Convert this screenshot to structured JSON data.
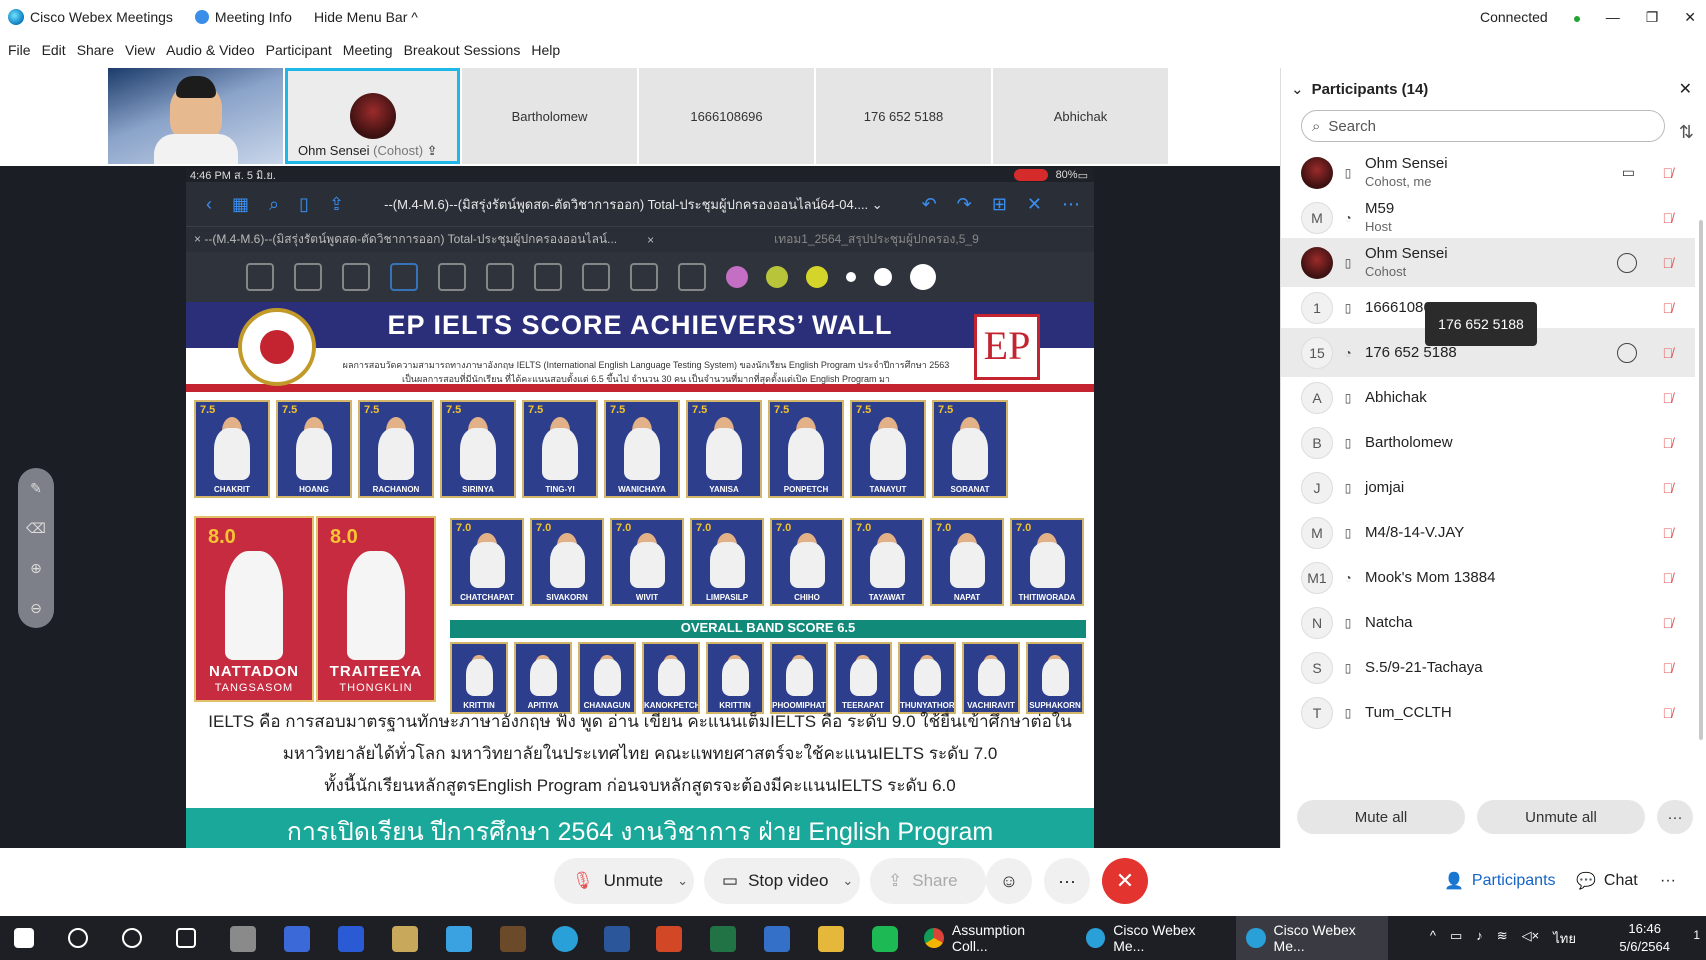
{
  "titlebar": {
    "app_name": "Cisco Webex Meetings",
    "meeting_info": "Meeting Info",
    "hide_menu": "Hide Menu Bar ^",
    "connection": "Connected",
    "win_minimize": "—",
    "win_restore": "❐",
    "win_close": "✕"
  },
  "menu": [
    "File",
    "Edit",
    "Share",
    "View",
    "Audio & Video",
    "Participant",
    "Meeting",
    "Breakout Sessions",
    "Help"
  ],
  "thumbnails": {
    "t2_name": "Ohm Sensei",
    "t2_role": "(Cohost)",
    "t3": "Bartholomew",
    "t4": "1666108696",
    "t5": "176 652 5188",
    "t6": "Abhichak"
  },
  "tablet": {
    "time": "4:46 PM  ส. 5 มิ.ย.",
    "battery": "80%",
    "doc_title": "--(M.4-M.6)--(มิสรุ่งรัตน์พูดสด-ตัดวิชาการออก) Total-ประชุมผู้ปกครองออนไลน์64-04.... ⌄",
    "tab1": "×  --(M.4-M.6)--(มิสรุ่งรัตน์พูดสด-ตัดวิชาการออก) Total-ประชุมผู้ปกครองออนไลน์...",
    "tab1_close": "×",
    "tab2": "เทอม1_2564_สรุปประชุมผู้ปกครอง,5_9"
  },
  "poster": {
    "title": "EP IELTS SCORE ACHIEVERS’ WALL",
    "logo": "EP",
    "sub1": "ผลการสอบวัดความสามารถทางภาษาอังกฤษ IELTS (International English Language Testing System) ของนักเรียน English Program ประจำปีการศึกษา 2563",
    "sub2": "เป็นผลการสอบที่มีนักเรียน ที่ได้คะแนนสอบตั้งแต่ 6.5 ขึ้นไป จำนวน 30 คน เป็นจำนวนที่มากที่สุดตั้งแต่เปิด English Program มา",
    "row1_score": "7.5",
    "row1": [
      "CHAKRIT",
      "HOANG",
      "RACHANON",
      "SIRINYA",
      "TING-YI",
      "WANICHAYA",
      "YANISA",
      "PONPETCH",
      "TANAYUT",
      "SORANAT"
    ],
    "big": [
      {
        "score": "8.0",
        "name": "NATTADON",
        "surname": "TANGSASOM"
      },
      {
        "score": "8.0",
        "name": "TRAITEEYA",
        "surname": "THONGKLIN"
      }
    ],
    "row2_score": "7.0",
    "row2": [
      "CHATCHAPAT",
      "SIVAKORN",
      "WIVIT",
      "LIMPASILP",
      "CHIHO",
      "TAYAWAT",
      "NAPAT",
      "THITIWORADA"
    ],
    "band_label": "OVERALL BAND SCORE 6.5",
    "row3": [
      "KRITTIN",
      "APITIYA",
      "CHANAGUN",
      "KANOKPETCH",
      "KRITTIN",
      "PHOOMIPHAT",
      "TEERAPAT",
      "THUNYATHORN",
      "VACHIRAVIT",
      "SUPHAKORN"
    ],
    "line1": "IELTS คือ การสอบมาตรฐานทักษะภาษาอังกฤษ ฟัง พูด อ่าน เขียน คะแนนเต็มIELTS คือ ระดับ 9.0 ใช้ยื่นเข้าศึกษาต่อใน",
    "line2": "มหาวิทยาลัยได้ทั่วโลก มหาวิทยาลัยในประเทศไทย คณะแพทยศาสตร์จะใช้คะแนนIELTS ระดับ 7.0",
    "line3": "ทั้งนี้นักเรียนหลักสูตรEnglish Program ก่อนจบหลักสูตรจะต้องมีคะแนนIELTS ระดับ 6.0",
    "banner": "การเปิดเรียน ปีการศึกษา 2564 งานวิชาการ ฝ่าย English Program"
  },
  "panel": {
    "title": "Participants (14)",
    "close": "✕",
    "search_placeholder": "Search",
    "tooltip": "176 652 5188",
    "participants": [
      {
        "avatar": "",
        "name": "Ohm Sensei",
        "role": "Cohost, me"
      },
      {
        "avatar": "M",
        "name": "M59",
        "role": "Host"
      },
      {
        "avatar": "",
        "name": "Ohm Sensei",
        "role": "Cohost"
      },
      {
        "avatar": "1",
        "name": "16661086",
        "role": ""
      },
      {
        "avatar": "15",
        "name": "176 652 5188",
        "role": ""
      },
      {
        "avatar": "A",
        "name": "Abhichak",
        "role": ""
      },
      {
        "avatar": "B",
        "name": "Bartholomew",
        "role": ""
      },
      {
        "avatar": "J",
        "name": "jomjai",
        "role": ""
      },
      {
        "avatar": "M",
        "name": "M4/8-14-V.JAY",
        "role": ""
      },
      {
        "avatar": "M1",
        "name": "Mook's Mom 13884",
        "role": ""
      },
      {
        "avatar": "N",
        "name": "Natcha",
        "role": ""
      },
      {
        "avatar": "S",
        "name": "S.5/9-21-Tachaya",
        "role": ""
      },
      {
        "avatar": "T",
        "name": "Tum_CCLTH",
        "role": ""
      }
    ],
    "mute_all": "Mute all",
    "unmute_all": "Unmute all",
    "more": "···"
  },
  "controls": {
    "unmute": "Unmute",
    "stop_video": "Stop video",
    "share": "Share",
    "more": "···",
    "participants": "Participants",
    "chat": "Chat"
  },
  "taskbar": {
    "app1": "Assumption Coll...",
    "app2": "Cisco Webex Me...",
    "app3": "Cisco Webex Me...",
    "time": "16:46",
    "date": "5/6/2564",
    "lang": "ไทย",
    "notif": "1"
  },
  "colors": {
    "accent": "#1463c7",
    "end_call": "#e3342f",
    "active_thumb_border": "#1fb7e6",
    "mute_red": "#e65555",
    "poster_navy": "#2b2f7a",
    "poster_red": "#c3242f",
    "poster_teal": "#1aa89a"
  }
}
